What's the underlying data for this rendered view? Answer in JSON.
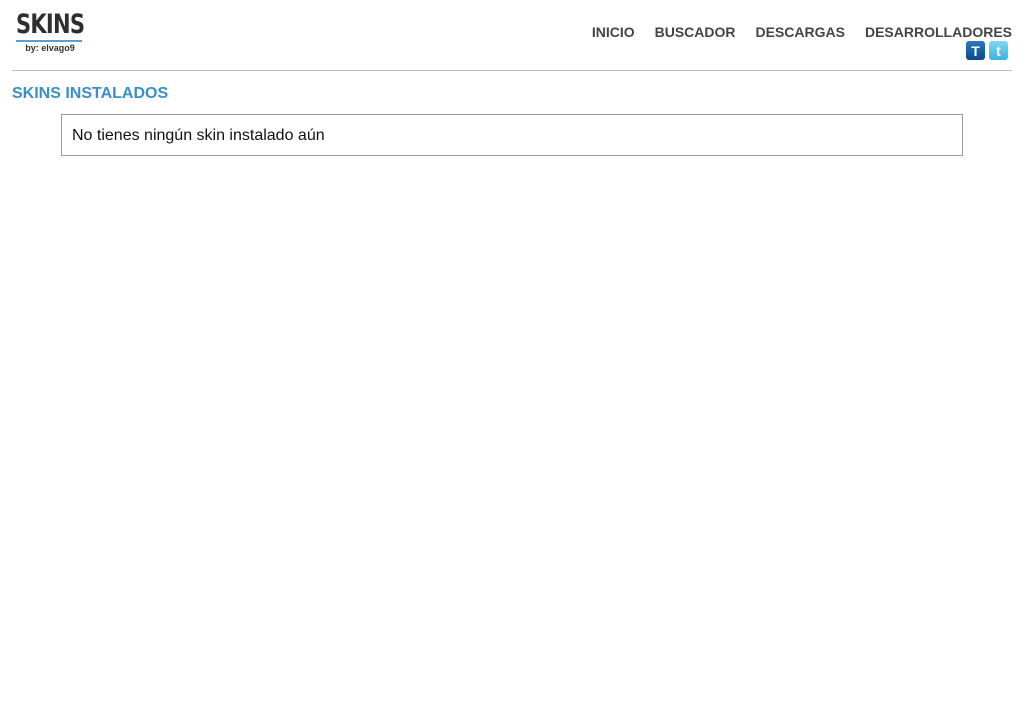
{
  "logo": {
    "title": "SKINS",
    "byline": "by: elvago9"
  },
  "nav": [
    "INICIO",
    "BUSCADOR",
    "DESCARGAS",
    "DESARROLLADORES"
  ],
  "social": [
    {
      "icon": "tuenti-icon",
      "glyph": "T"
    },
    {
      "icon": "twitter-icon",
      "glyph": "t"
    }
  ],
  "section": {
    "title": "SKINS INSTALADOS",
    "empty_message": "No tienes ningún skin instalado aún"
  }
}
